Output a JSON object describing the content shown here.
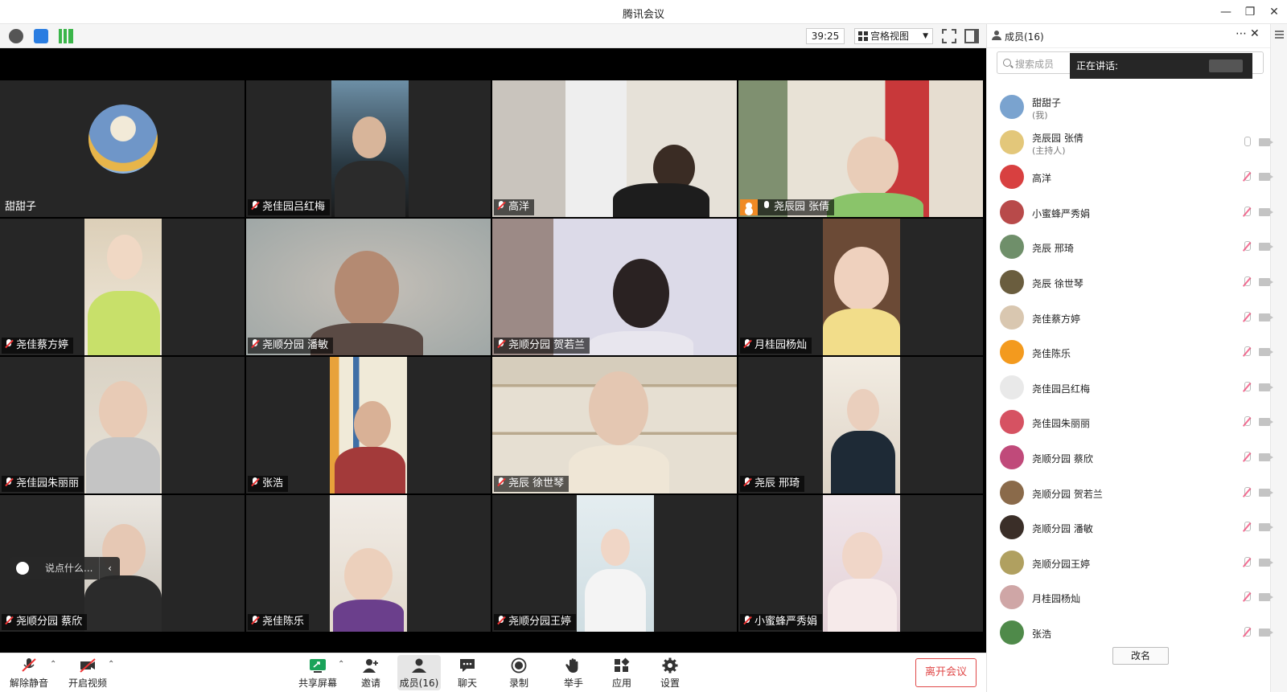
{
  "window": {
    "title": "腾讯会议"
  },
  "toolbar": {
    "timer": "39:25",
    "view_mode": "宫格视图"
  },
  "tiles": [
    {
      "name": "甜甜子",
      "mic": "none"
    },
    {
      "name": "尧佳园吕红梅",
      "mic": "muted"
    },
    {
      "name": "高洋",
      "mic": "muted"
    },
    {
      "name": "尧辰园 张倩",
      "mic": "on",
      "host": true
    },
    {
      "name": "尧佳蔡方婷",
      "mic": "muted"
    },
    {
      "name": "尧顺分园 潘敏",
      "mic": "muted"
    },
    {
      "name": "尧顺分园 贺若兰",
      "mic": "muted"
    },
    {
      "name": "月桂园杨灿",
      "mic": "muted"
    },
    {
      "name": "尧佳园朱丽丽",
      "mic": "muted"
    },
    {
      "name": "张浩",
      "mic": "muted"
    },
    {
      "name": "尧辰  徐世琴",
      "mic": "muted"
    },
    {
      "name": "尧辰  邢琦",
      "mic": "muted"
    },
    {
      "name": "尧顺分园 蔡欣",
      "mic": "muted"
    },
    {
      "name": "尧佳陈乐",
      "mic": "muted"
    },
    {
      "name": "尧顺分园王婷",
      "mic": "muted"
    },
    {
      "name": "小蜜蜂严秀娟",
      "mic": "muted"
    }
  ],
  "chat_input": {
    "placeholder": "说点什么..."
  },
  "bottom_controls": {
    "unmute": "解除静音",
    "start_video": "开启视频",
    "share_screen": "共享屏幕",
    "invite": "邀请",
    "members": "成员(16)",
    "chat": "聊天",
    "record": "录制",
    "raise_hand": "举手",
    "apps": "应用",
    "settings": "设置",
    "leave": "离开会议"
  },
  "members_panel": {
    "title": "成员(16)",
    "search_placeholder": "搜索成员",
    "speaking_label": "正在讲话:",
    "rename_button": "改名",
    "members": [
      {
        "name": "甜甜子",
        "role": "(我)",
        "color": "#7aa3cf"
      },
      {
        "name": "尧辰园 张倩",
        "role": "(主持人)",
        "color": "#e3c77a"
      },
      {
        "name": "高洋",
        "role": "",
        "color": "#d84040"
      },
      {
        "name": "小蜜蜂严秀娟",
        "role": "",
        "color": "#b84a4a"
      },
      {
        "name": "尧辰  邢琦",
        "role": "",
        "color": "#6f8f6a"
      },
      {
        "name": "尧辰  徐世琴",
        "role": "",
        "color": "#6a5d3e"
      },
      {
        "name": "尧佳蔡方婷",
        "role": "",
        "color": "#d9c7b0"
      },
      {
        "name": "尧佳陈乐",
        "role": "",
        "color": "#f39a1e"
      },
      {
        "name": "尧佳园吕红梅",
        "role": "",
        "color": "#e9e9e9"
      },
      {
        "name": "尧佳园朱丽丽",
        "role": "",
        "color": "#d65262"
      },
      {
        "name": "尧顺分园 蔡欣",
        "role": "",
        "color": "#c04a7a"
      },
      {
        "name": "尧顺分园 贺若兰",
        "role": "",
        "color": "#8a6a4a"
      },
      {
        "name": "尧顺分园 潘敏",
        "role": "",
        "color": "#3a2e28"
      },
      {
        "name": "尧顺分园王婷",
        "role": "",
        "color": "#b0a060"
      },
      {
        "name": "月桂园杨灿",
        "role": "",
        "color": "#cfa6a6"
      },
      {
        "name": "张浩",
        "role": "",
        "color": "#4f8a4a"
      }
    ]
  }
}
